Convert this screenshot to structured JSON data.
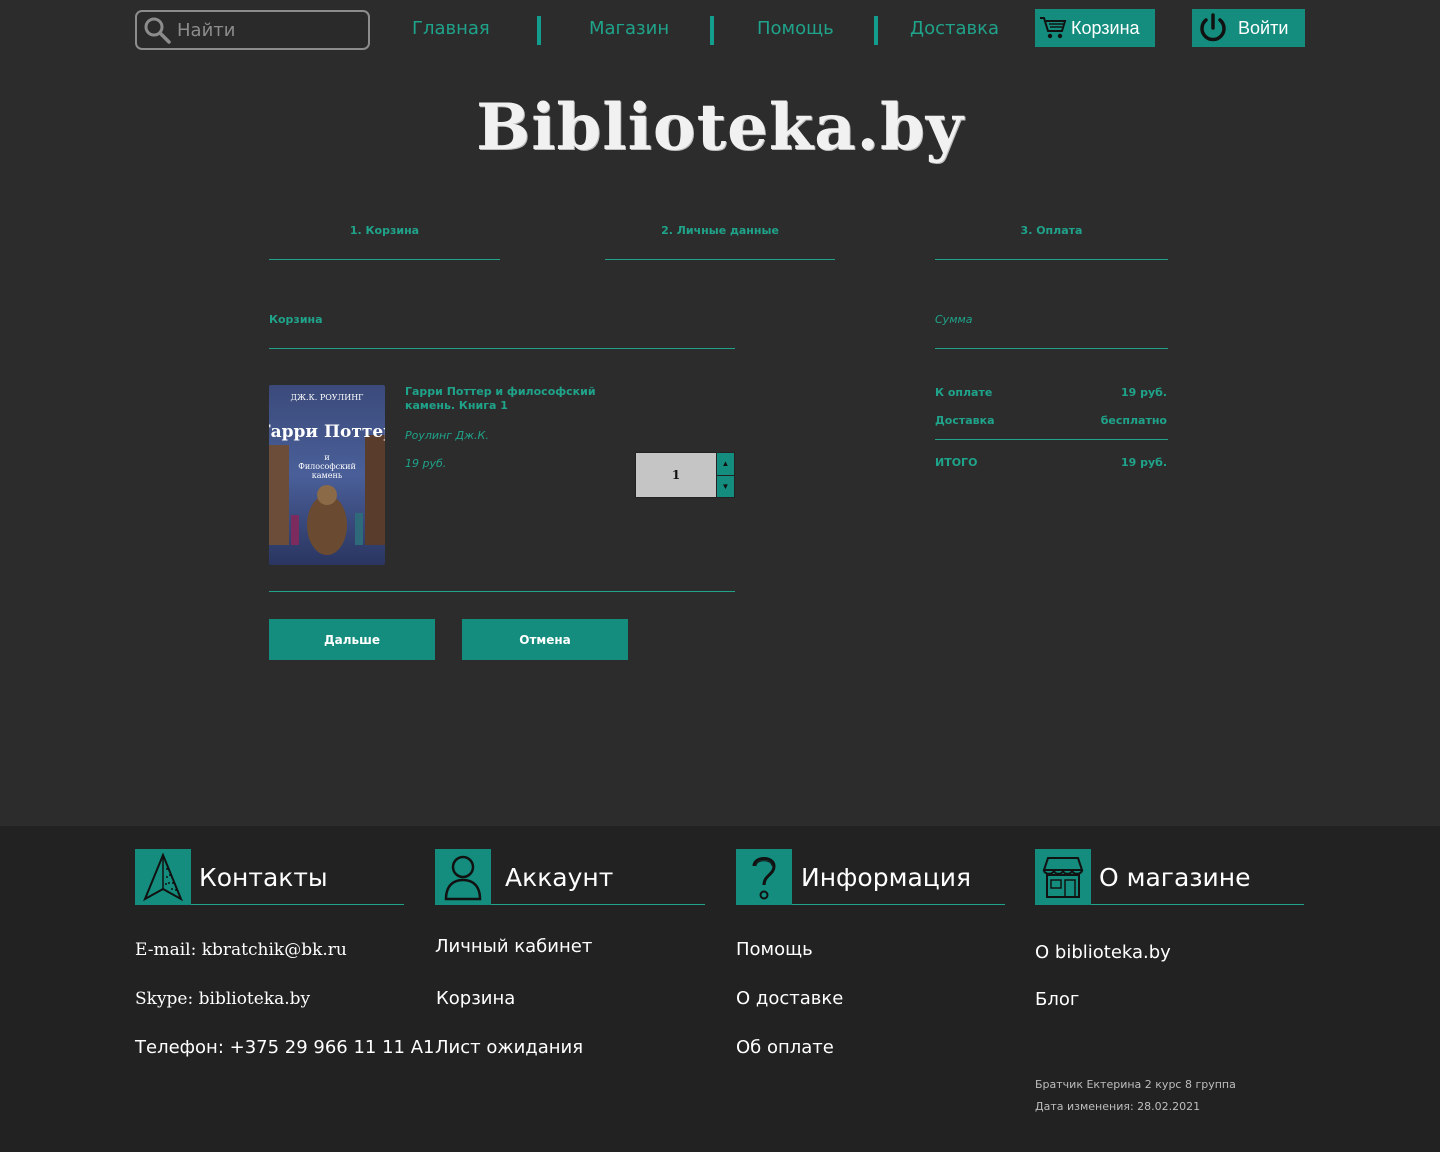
{
  "header": {
    "search_placeholder": "Найти",
    "nav": [
      "Главная",
      "Магазин",
      "Помощь",
      "Доставка"
    ],
    "cart_label": "Корзина",
    "login_label": "Войти",
    "logo": "Biblioteka.by"
  },
  "steps": [
    "1. Корзина",
    "2. Личные данные",
    "3. Оплата"
  ],
  "cart": {
    "title": "Корзина",
    "item": {
      "title": "Гарри Поттер и философский камень. Книга 1",
      "author": "Роулинг Дж.К.",
      "price": "19 руб.",
      "quantity": "1",
      "cover_text": [
        "ДЖ.К. РОУЛИНГ",
        "Гарри Поттер",
        "и",
        "Философский",
        "камень"
      ]
    },
    "next_label": "Дальше",
    "cancel_label": "Отмена"
  },
  "summary": {
    "title": "Сумма",
    "to_pay_label": "К оплате",
    "to_pay_value": "19 руб.",
    "delivery_label": "Доставка",
    "delivery_value": "бесплатно",
    "total_label": "ИТОГО",
    "total_value": "19 руб."
  },
  "footer": {
    "contacts": {
      "title": "Контакты",
      "email": "E-mail: kbratchik@bk.ru",
      "skype": "Skype: biblioteka.by",
      "phone": "Телефон: +375 29 966 11 11 A1"
    },
    "account": {
      "title": "Аккаунт",
      "links": [
        "Личный кабинет",
        "Корзина",
        "Лист ожидания"
      ]
    },
    "info": {
      "title": "Информация",
      "links": [
        "Помощь",
        "О доставке",
        "Об оплате"
      ]
    },
    "shop": {
      "title": "О магазине",
      "links": [
        "О biblioteka.by",
        "Блог"
      ],
      "author": "Братчик Ектерина 2 курс 8 группа",
      "modified": "Дата изменения: 28.02.2021"
    }
  },
  "colors": {
    "accent": "#1fa38a",
    "button": "#148d7e",
    "background": "#2c2c2c",
    "footer": "#222222"
  }
}
